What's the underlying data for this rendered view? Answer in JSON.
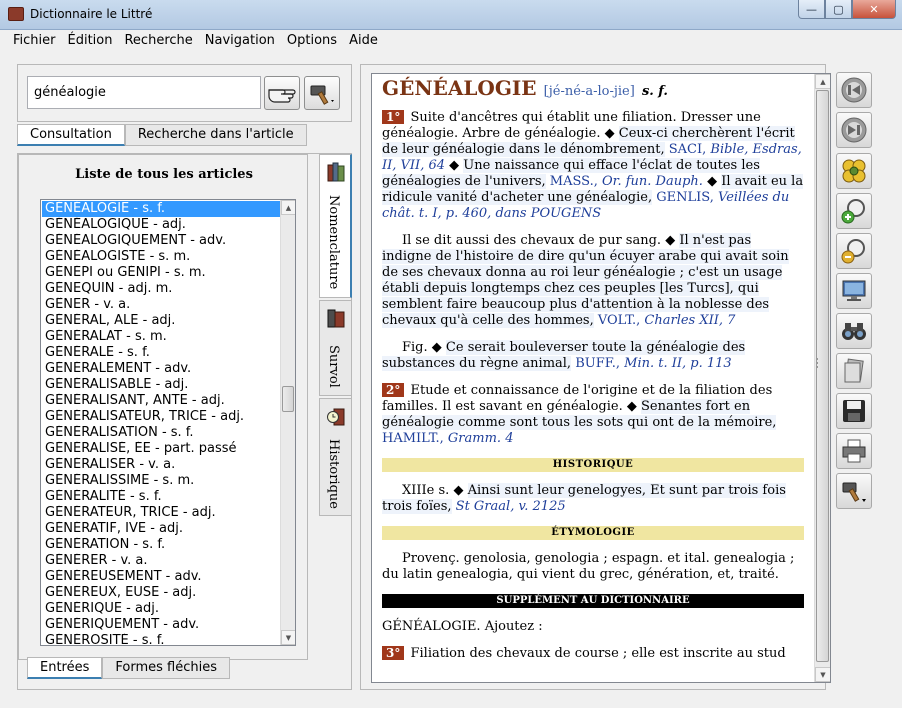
{
  "window": {
    "title": "Dictionnaire le Littré",
    "minimize_glyph": "—",
    "maximize_glyph": "▢",
    "close_glyph": "✕"
  },
  "menu": [
    "Fichier",
    "Édition",
    "Recherche",
    "Navigation",
    "Options",
    "Aide"
  ],
  "search": {
    "value": "généalogie"
  },
  "top_tabs": [
    {
      "label": "Consultation",
      "active": true
    },
    {
      "label": "Recherche dans l'article",
      "active": false
    }
  ],
  "list": {
    "heading": "Liste de tous les articles",
    "items": [
      "GÉNÉALOGIE - s. f.",
      "GÉNÉALOGIQUE - adj.",
      "GÉNÉALOGIQUEMENT - adv.",
      "GÉNÉALOGISTE - s. m.",
      "GÉNÉPI ou GÉNIPI - s. m.",
      "GÉNEQUIN - adj. m.",
      "GÊNER - v. a.",
      "GÉNÉRAL, ALE - adj.",
      "GÉNÉRALAT - s. m.",
      "GÉNÉRALE - s. f.",
      "GÉNÉRALEMENT - adv.",
      "GÉNÉRALISABLE - adj.",
      "GÉNÉRALISANT, ANTE - adj.",
      "GÉNÉRALISATEUR, TRICE - adj.",
      "GÉNÉRALISATION - s. f.",
      "GÉNÉRALISÉ, ÉE - part. passé",
      "GÉNÉRALISER - v. a.",
      "GÉNÉRALISSIME - s. m.",
      "GÉNÉRALITÉ - s. f.",
      "GÉNÉRATEUR, TRICE - adj.",
      "GÉNÉRATIF, IVE - adj.",
      "GÉNÉRATION - s. f.",
      "GÉNÉRER - v. a.",
      "GÉNÉREUSEMENT - adv.",
      "GÉNÉREUX, EUSE - adj.",
      "GÉNÉRIQUE - adj.",
      "GÉNÉRIQUEMENT - adv.",
      "GÉNÉROSITÉ - s. f."
    ],
    "selected_index": 0
  },
  "side_tabs": [
    {
      "label": "Nomenclature",
      "active": true,
      "icon": "books-icon"
    },
    {
      "label": "Survol",
      "active": false,
      "icon": "books-stack-icon"
    },
    {
      "label": "Historique",
      "active": false,
      "icon": "clock-books-icon"
    }
  ],
  "bottom_tabs": [
    {
      "label": "Entrées",
      "active": true
    },
    {
      "label": "Formes fléchies",
      "active": false
    }
  ],
  "article": {
    "headword": "GÉNÉALOGIE",
    "pronunciation": "[jé-né-a-lo-jie]",
    "grammar": "s. f.",
    "sense1": {
      "num": "1°",
      "def": "Suite d'ancêtres qui établit une filiation. Dresser une généalogie. Arbre de généalogie.",
      "quote1": "Ceux-ci cherchèrent l'écrit de leur généalogie dans le dénombrement,",
      "ref1_author": "SACI,",
      "ref1_work": "Bible, Esdras, II, VII, 64",
      "quote2": "Une naissance qui efface l'éclat de toutes les généalogies de l'univers,",
      "ref2_author": "MASS.,",
      "ref2_work": "Or. fun. Dauph.",
      "quote3": "Il avait eu la ridicule vanité d'acheter une généalogie,",
      "ref3_author": "GENLIS,",
      "ref3_work": "Veillées du chât. t. I, p. 460, dans POUGENS"
    },
    "par2_lead": "Il se dit aussi des chevaux de pur sang.",
    "par2_quote": "Il n'est pas indigne de l'histoire de dire qu'un écuyer arabe qui avait soin de ses chevaux donna au roi leur généalogie ; c'est un usage établi depuis longtemps chez ces peuples [les Turcs], qui semblent faire beaucoup plus d'attention à la noblesse des chevaux qu'à celle des hommes,",
    "par2_ref_author": "VOLT.,",
    "par2_ref_work": "Charles XII, 7",
    "par3_lead": "Fig.",
    "par3_quote": "Ce serait bouleverser toute la généalogie des substances du règne animal,",
    "par3_ref_author": "BUFF.,",
    "par3_ref_work": "Min. t. II, p. 113",
    "sense2": {
      "num": "2°",
      "def": "Etude et connaissance de l'origine et de la filiation des familles. Il est savant en généalogie.",
      "quote": "Senantes fort en généalogie comme sont tous les sots qui ont de la mémoire,",
      "ref_author": "HAMILT.,",
      "ref_work": "Gramm. 4"
    },
    "historique_title": "HISTORIQUE",
    "historique_lead": "XIIIe s.",
    "historique_quote": "Ainsi sunt leur genelogyes, Et sunt par trois fois trois foïes,",
    "historique_ref": "St Graal, v. 2125",
    "etymologie_title": "ÉTYMOLOGIE",
    "etymologie_text": "Provenç. genolosia, genologia ; espagn. et ital. genealogia ; du latin genealogia, qui vient du grec, génération, et, traité.",
    "supplement_title": "SUPPLÉMENT AU DICTIONNAIRE",
    "supplement_lead": "GÉNÉALOGIE. Ajoutez :",
    "supplement_num": "3°",
    "supplement_text": "Filiation des chevaux de course ; elle est inscrite au stud"
  },
  "toolbar_icons": [
    "back-icon",
    "forward-icon",
    "flower-icon",
    "zoom-in-icon",
    "zoom-out-icon",
    "monitor-icon",
    "binoculars-icon",
    "pages-icon",
    "save-icon",
    "print-icon",
    "hammer-icon"
  ],
  "colors": {
    "headword": "#7a3414",
    "sense_badge": "#a0371a",
    "reference": "#1f3f9a",
    "section_banner": "#f0e6a1",
    "selection": "#3399ff"
  }
}
